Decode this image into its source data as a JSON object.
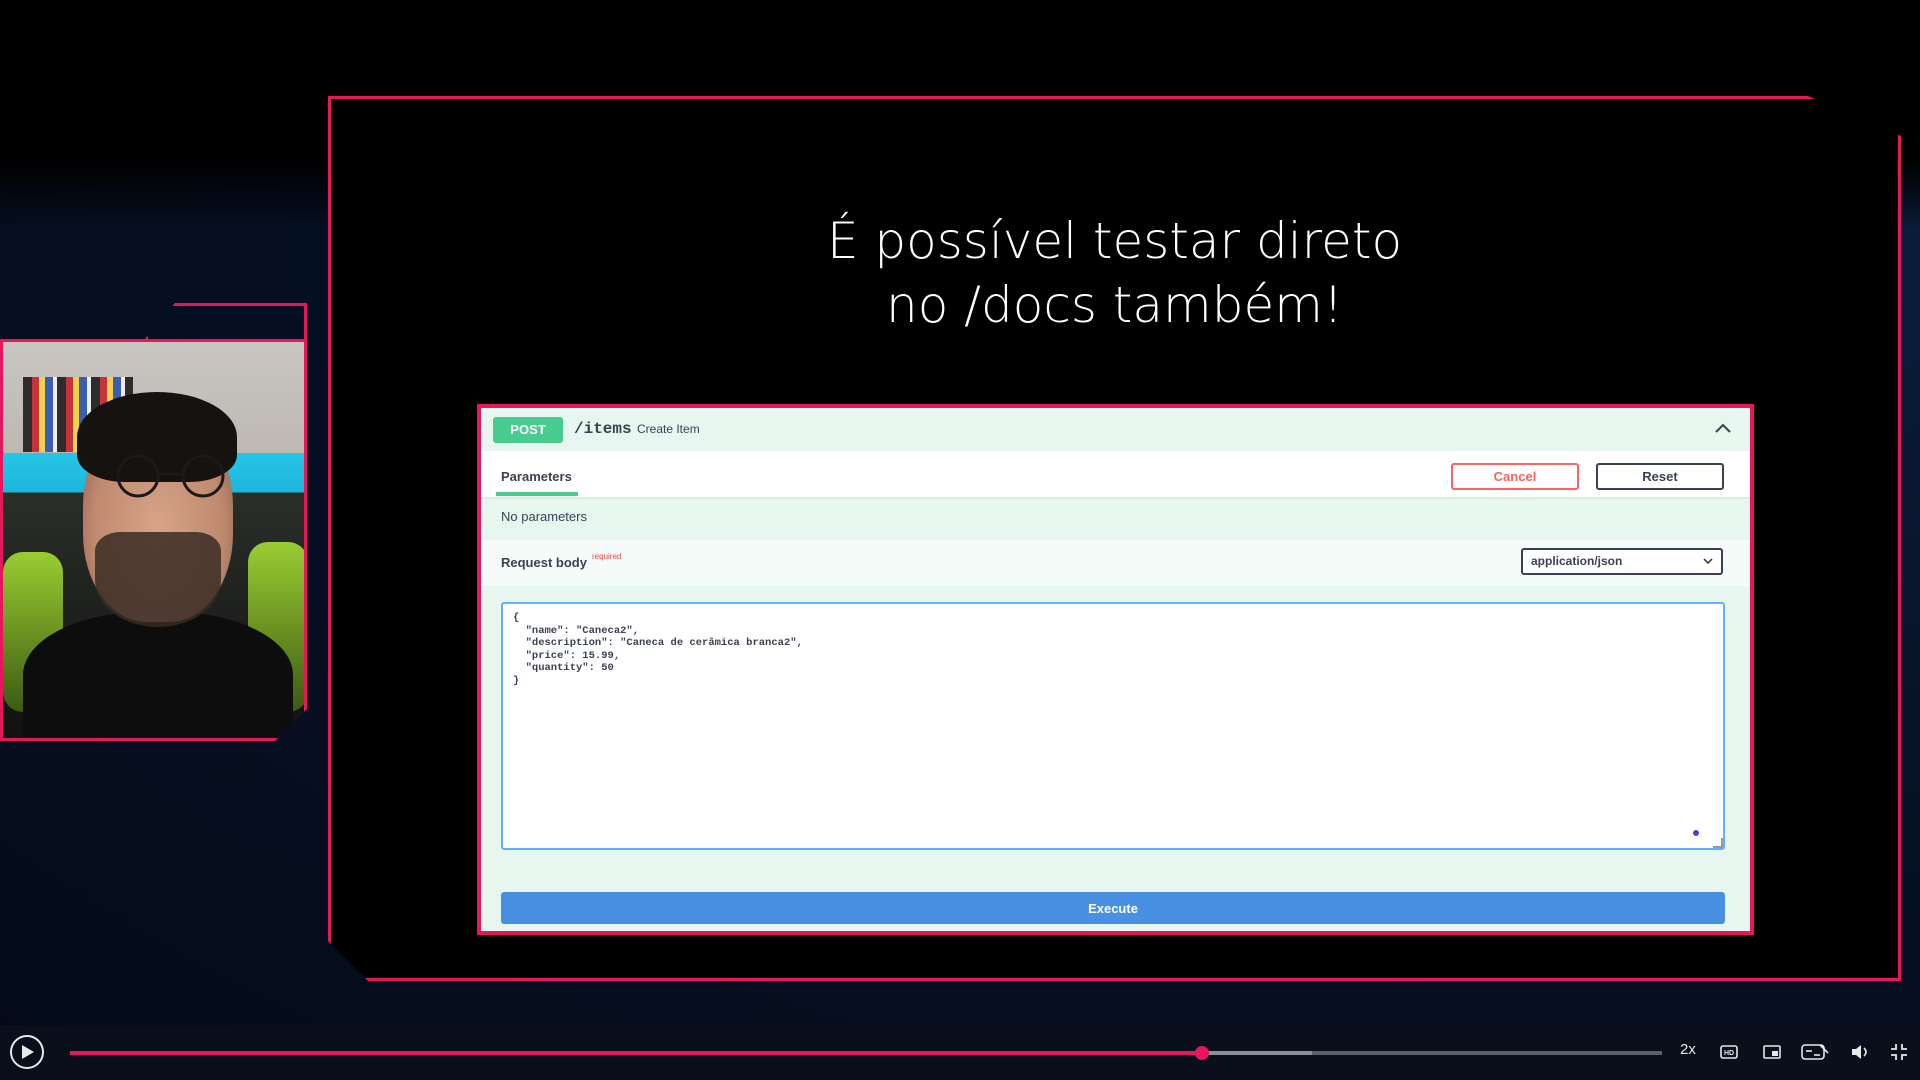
{
  "slide": {
    "title_line1": "É possível testar direto",
    "title_line2": "no /docs também!"
  },
  "swagger": {
    "method": "POST",
    "path": "/items",
    "summary": "Create Item",
    "tab_label": "Parameters",
    "cancel_label": "Cancel",
    "reset_label": "Reset",
    "no_params": "No parameters",
    "request_body_label": "Request body",
    "required_label": "required",
    "content_type": "application/json",
    "body": "{\n  \"name\": \"Caneca2\",\n  \"description\": \"Caneca de cerâmica branca2\",\n  \"price\": 15.99,\n  \"quantity\": 50\n}",
    "execute_label": "Execute",
    "accent_color": "#49cc90",
    "execute_color": "#4990e2"
  },
  "player": {
    "speed": "2x",
    "progress_fraction": 0.711,
    "buffered_fraction": 0.78,
    "accent_color": "#e8175d",
    "icons": [
      "play-icon",
      "hd-icon",
      "picture-in-picture-icon",
      "subtitles-icon",
      "volume-icon",
      "fullscreen-exit-icon"
    ]
  }
}
